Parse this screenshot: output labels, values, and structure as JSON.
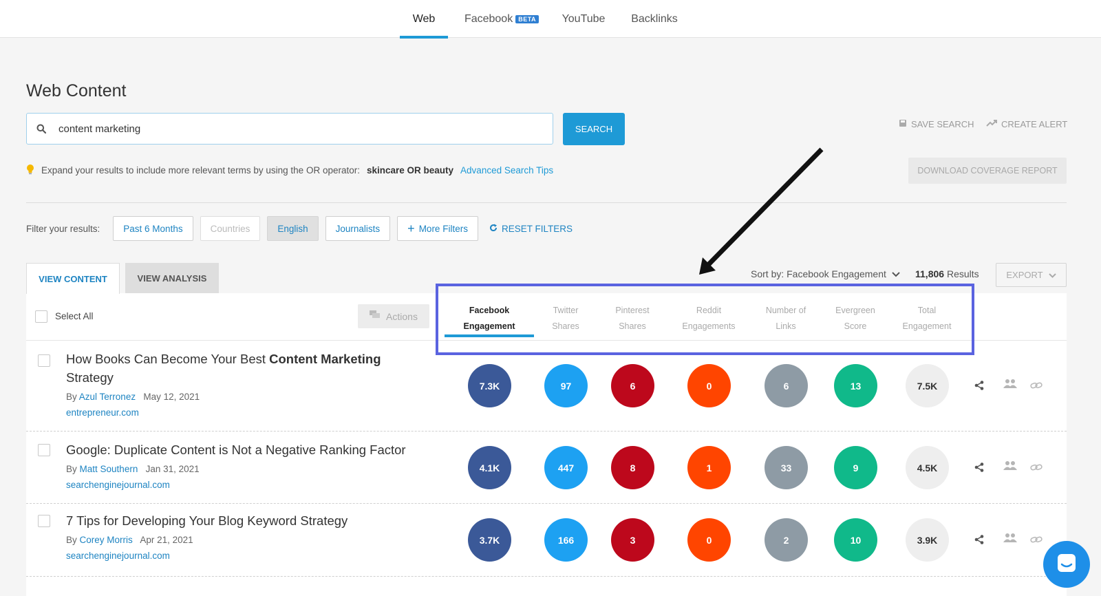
{
  "nav": {
    "tabs": [
      {
        "label": "Web",
        "active": true
      },
      {
        "label": "Facebook",
        "badge": "BETA"
      },
      {
        "label": "YouTube"
      },
      {
        "label": "Backlinks"
      }
    ]
  },
  "page_title": "Web Content",
  "search": {
    "value": "content marketing",
    "button": "SEARCH",
    "save_search": "SAVE SEARCH",
    "create_alert": "CREATE ALERT"
  },
  "tip": {
    "text": "Expand your results to include more relevant terms by using the OR operator:",
    "example": "skincare OR beauty",
    "link": "Advanced Search Tips"
  },
  "download_report": "DOWNLOAD COVERAGE REPORT",
  "filters": {
    "label": "Filter your results:",
    "buttons": [
      "Past 6 Months",
      "Countries",
      "English",
      "Journalists"
    ],
    "more_filters": "More Filters",
    "reset": "RESET FILTERS"
  },
  "view_tabs": {
    "content": "VIEW CONTENT",
    "analysis": "VIEW ANALYSIS"
  },
  "sort": {
    "label": "Sort by: Facebook Engagement",
    "count": "11,806",
    "results_label": "Results",
    "export": "EXPORT"
  },
  "table": {
    "select_all": "Select All",
    "actions": "Actions",
    "columns": [
      {
        "line1": "Facebook",
        "line2": "Engagement",
        "active": true
      },
      {
        "line1": "Twitter",
        "line2": "Shares"
      },
      {
        "line1": "Pinterest",
        "line2": "Shares"
      },
      {
        "line1": "Reddit",
        "line2": "Engagements"
      },
      {
        "line1": "Number of",
        "line2": "Links"
      },
      {
        "line1": "Evergreen",
        "line2": "Score"
      },
      {
        "line1": "Total",
        "line2": "Engagement"
      }
    ],
    "metric_colors": [
      "#3b5998",
      "#1da1f2",
      "#bd081c",
      "#ff4500",
      "#8e9ba5",
      "#10b98a",
      "#eeeeee"
    ],
    "rows": [
      {
        "title_plain": "How Books Can Become Your Best",
        "title_bold": "Content Marketing",
        "title_tail": "Strategy",
        "by": "By",
        "author": "Azul Terronez",
        "date": "May 12, 2021",
        "domain": "entrepreneur.com",
        "values": [
          "7.3K",
          "97",
          "6",
          "0",
          "6",
          "13",
          "7.5K"
        ]
      },
      {
        "title_plain": "Google: Duplicate Content is Not a Negative Ranking Factor",
        "title_bold": "",
        "title_tail": "",
        "by": "By",
        "author": "Matt Southern",
        "date": "Jan 31, 2021",
        "domain": "searchenginejournal.com",
        "values": [
          "4.1K",
          "447",
          "8",
          "1",
          "33",
          "9",
          "4.5K"
        ]
      },
      {
        "title_plain": "7 Tips for Developing Your Blog Keyword Strategy",
        "title_bold": "",
        "title_tail": "",
        "by": "By",
        "author": "Corey Morris",
        "date": "Apr 21, 2021",
        "domain": "searchenginejournal.com",
        "values": [
          "3.7K",
          "166",
          "3",
          "0",
          "2",
          "10",
          "3.9K"
        ]
      }
    ]
  }
}
